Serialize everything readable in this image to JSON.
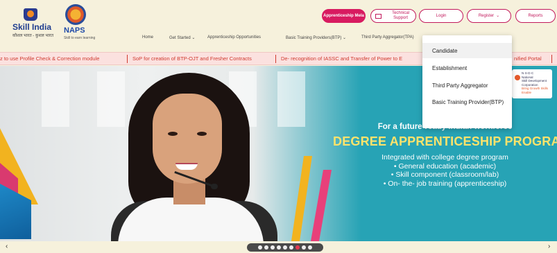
{
  "header": {
    "skill_india_title": "Skill India",
    "skill_india_tagline": "कौशल भारत - कुशल भारत",
    "naps_title": "NAPS",
    "naps_tagline": "Skill to earn learning",
    "degree_btn": "Apprenticeship Mela",
    "tech_support_btn": "Technical Support",
    "login_btn": "Login",
    "register_btn": "Register",
    "reports_btn": "Reports"
  },
  "nav": {
    "items": [
      "Home",
      "Get Started",
      "Apprenticeship Opportunities",
      "Basic Training Providers(BTP)",
      "Third Party Aggregator(TPA)"
    ]
  },
  "ticker": {
    "items": [
      "z to use Profile Check & Correction module",
      "SoP for creation of BTP-OJT and Fresher Contracts",
      "De- recognition of IASSC and Transfer of Power to E",
      "nified Portal"
    ]
  },
  "register_menu": {
    "items": [
      "Candidate",
      "Establishment",
      "Third Party Aggregator",
      "Basic Training Provider(BTP)"
    ],
    "active_index": 0
  },
  "nsdc_card": {
    "line1": "N·S·D·C",
    "line2": "National",
    "line3": "Skill Development",
    "line4": "Corporation",
    "line5": "Bring Growth Skills Enable"
  },
  "banner": {
    "line1": "For a future-ready Indian workforce",
    "line2": "DEGREE APPRENTICESHIP PROGRAM",
    "line3": "Integrated with college degree program",
    "bullets": [
      "• General education (academic)",
      "• Skill component (classroom/lab)",
      "• On- the- job training (apprenticeship)"
    ]
  },
  "carousel": {
    "prev": "‹",
    "next": "›",
    "dot_count": 9,
    "active_dot": 6
  },
  "colors": {
    "accent": "#d81b60",
    "banner_bg": "#27a3b5",
    "headline": "#ffe36b",
    "ticker_text": "#d0392e"
  }
}
